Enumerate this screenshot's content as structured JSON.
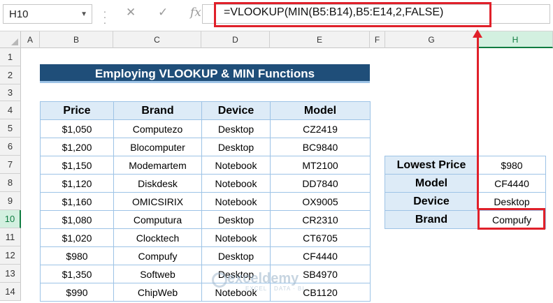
{
  "name_box": "H10",
  "formula_bar": {
    "fx_label": "fx",
    "formula": "=VLOOKUP(MIN(B5:B14),B5:E14,2,FALSE)"
  },
  "columns": [
    "A",
    "B",
    "C",
    "D",
    "E",
    "F",
    "G",
    "H"
  ],
  "rows": [
    "1",
    "2",
    "3",
    "4",
    "5",
    "6",
    "7",
    "8",
    "9",
    "10",
    "11",
    "12",
    "13",
    "14"
  ],
  "title": "Employing VLOOKUP & MIN Functions",
  "table": {
    "headers": [
      "Price",
      "Brand",
      "Device",
      "Model"
    ],
    "rows": [
      [
        "$1,050",
        "Computezo",
        "Desktop",
        "CZ2419"
      ],
      [
        "$1,200",
        "Blocomputer",
        "Desktop",
        "BC9840"
      ],
      [
        "$1,150",
        "Modemartem",
        "Notebook",
        "MT2100"
      ],
      [
        "$1,120",
        "Diskdesk",
        "Notebook",
        "DD7840"
      ],
      [
        "$1,160",
        "OMICSIRIX",
        "Notebook",
        "OX9005"
      ],
      [
        "$1,080",
        "Computura",
        "Desktop",
        "CR2310"
      ],
      [
        "$1,020",
        "Clocktech",
        "Notebook",
        "CT6705"
      ],
      [
        "$980",
        "Compufy",
        "Desktop",
        "CF4440"
      ],
      [
        "$1,350",
        "Softweb",
        "Desktop",
        "SB4970"
      ],
      [
        "$990",
        "ChipWeb",
        "Notebook",
        "CB1120"
      ]
    ]
  },
  "result": [
    {
      "label": "Lowest Price",
      "value": "$980"
    },
    {
      "label": "Model",
      "value": "CF4440"
    },
    {
      "label": "Device",
      "value": "Desktop"
    },
    {
      "label": "Brand",
      "value": "Compufy"
    }
  ],
  "watermark": {
    "name": "exceldemy",
    "tagline": "EXCEL · DATA · BI"
  },
  "colors": {
    "title_bg": "#1f4e79",
    "header_bg": "#ddebf7",
    "border": "#9dc3e6",
    "highlight": "#e0202a",
    "selected": "#107c41"
  }
}
